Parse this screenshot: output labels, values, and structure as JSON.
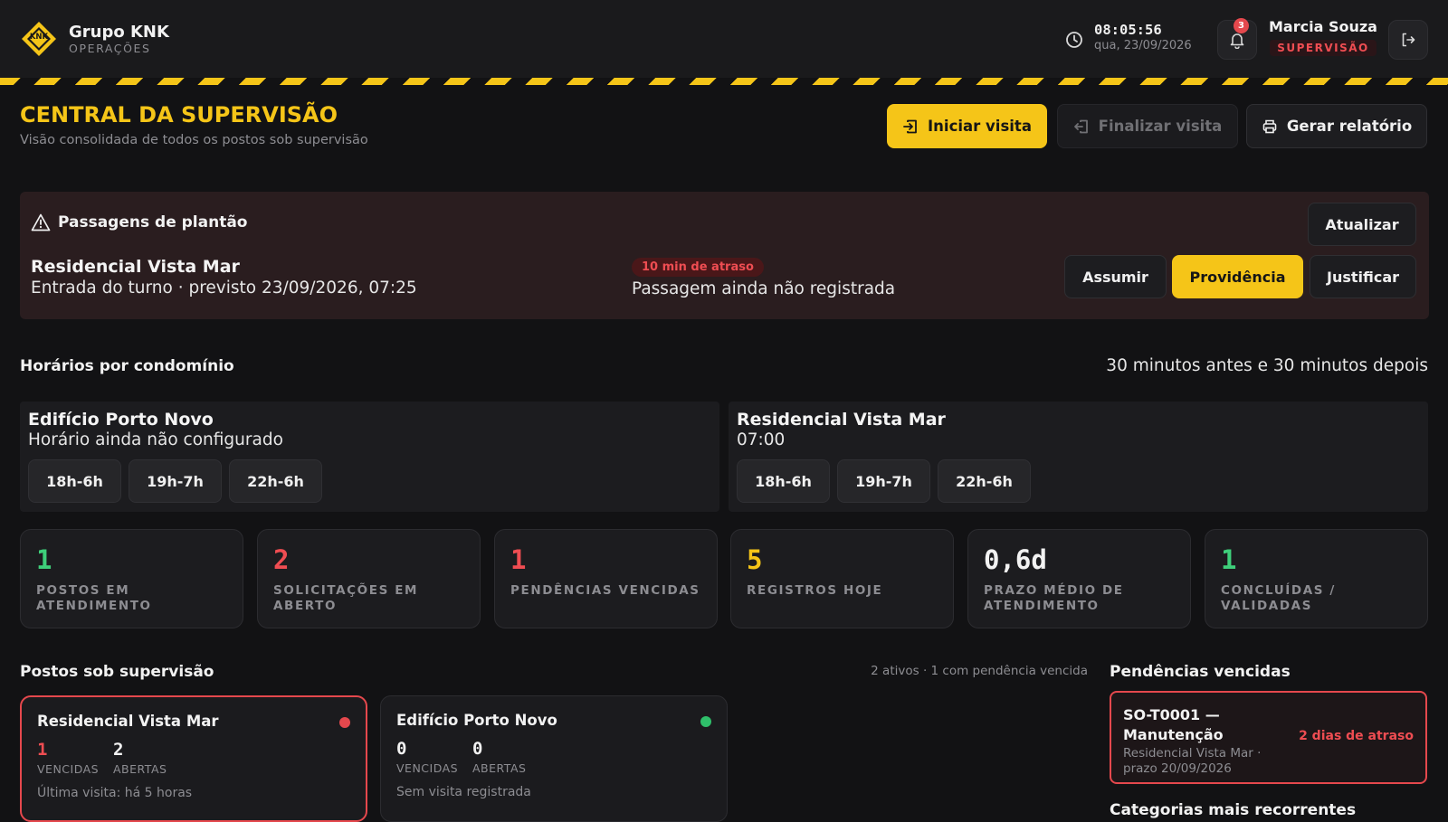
{
  "brand": {
    "name": "Grupo KNK",
    "subtitle": "OPERAÇÕES",
    "logo_text": "KNK"
  },
  "clock": {
    "time": "08:05:56",
    "date": "qua, 23/09/2026"
  },
  "notifications": {
    "count": "3"
  },
  "user": {
    "name": "Marcia Souza",
    "role": "SUPERVISÃO"
  },
  "page": {
    "title": "CENTRAL DA SUPERVISÃO",
    "subtitle": "Visão consolidada de todos os postos sob supervisão"
  },
  "actions": {
    "start_visit": "Iniciar visita",
    "end_visit": "Finalizar visita",
    "report": "Gerar relatório"
  },
  "alert": {
    "title": "Passagens de plantão",
    "refresh": "Atualizar",
    "site": "Residencial Vista Mar",
    "detail": "Entrada do turno · previsto 23/09/2026, 07:25",
    "delay": "10 min de atraso",
    "status": "Passagem ainda não registrada",
    "assume": "Assumir",
    "action": "Providência",
    "justify": "Justificar"
  },
  "schedules": {
    "title": "Horários por condomínio",
    "note": "30 minutos antes e 30 minutos depois",
    "cards": [
      {
        "name": "Edifício Porto Novo",
        "time": "Horário ainda não configurado",
        "shifts": [
          "18h-6h",
          "19h-7h",
          "22h-6h"
        ]
      },
      {
        "name": "Residencial Vista Mar",
        "time": "07:00",
        "shifts": [
          "18h-6h",
          "19h-7h",
          "22h-6h"
        ]
      }
    ]
  },
  "stats": [
    {
      "value": "1",
      "label": "Postos em atendimento",
      "color": "#3ecf7a"
    },
    {
      "value": "2",
      "label": "Solicitações em aberto",
      "color": "#ef4d52"
    },
    {
      "value": "1",
      "label": "Pendências vencidas",
      "color": "#ef4d52"
    },
    {
      "value": "5",
      "label": "Registros hoje",
      "color": "#f5c518"
    },
    {
      "value": "0,6d",
      "label": "Prazo médio de atendimento",
      "color": "#f2f2f2"
    },
    {
      "value": "1",
      "label": "Concluídas / validadas",
      "color": "#3ecf7a"
    }
  ],
  "posts": {
    "title": "Postos sob supervisão",
    "meta": "2 ativos · 1 com pendência vencida",
    "items": [
      {
        "name": "Residencial Vista Mar",
        "status_color": "#e5484d",
        "overdue": "1",
        "overdue_label": "VENCIDAS",
        "open": "2",
        "open_label": "ABERTAS",
        "last_visit": "Última visita: há 5 horas"
      },
      {
        "name": "Edifício Porto Novo",
        "status_color": "#2fbf6a",
        "overdue": "0",
        "overdue_label": "VENCIDAS",
        "open": "0",
        "open_label": "ABERTAS",
        "last_visit": "Sem visita registrada"
      }
    ]
  },
  "overdue": {
    "title": "Pendências vencidas",
    "items": [
      {
        "title": "SO-T0001 — Manutenção",
        "subtitle": "Residencial Vista Mar · prazo 20/09/2026",
        "badge": "2 dias de atraso"
      }
    ]
  },
  "categories": {
    "title": "Categorias mais recorrentes"
  }
}
